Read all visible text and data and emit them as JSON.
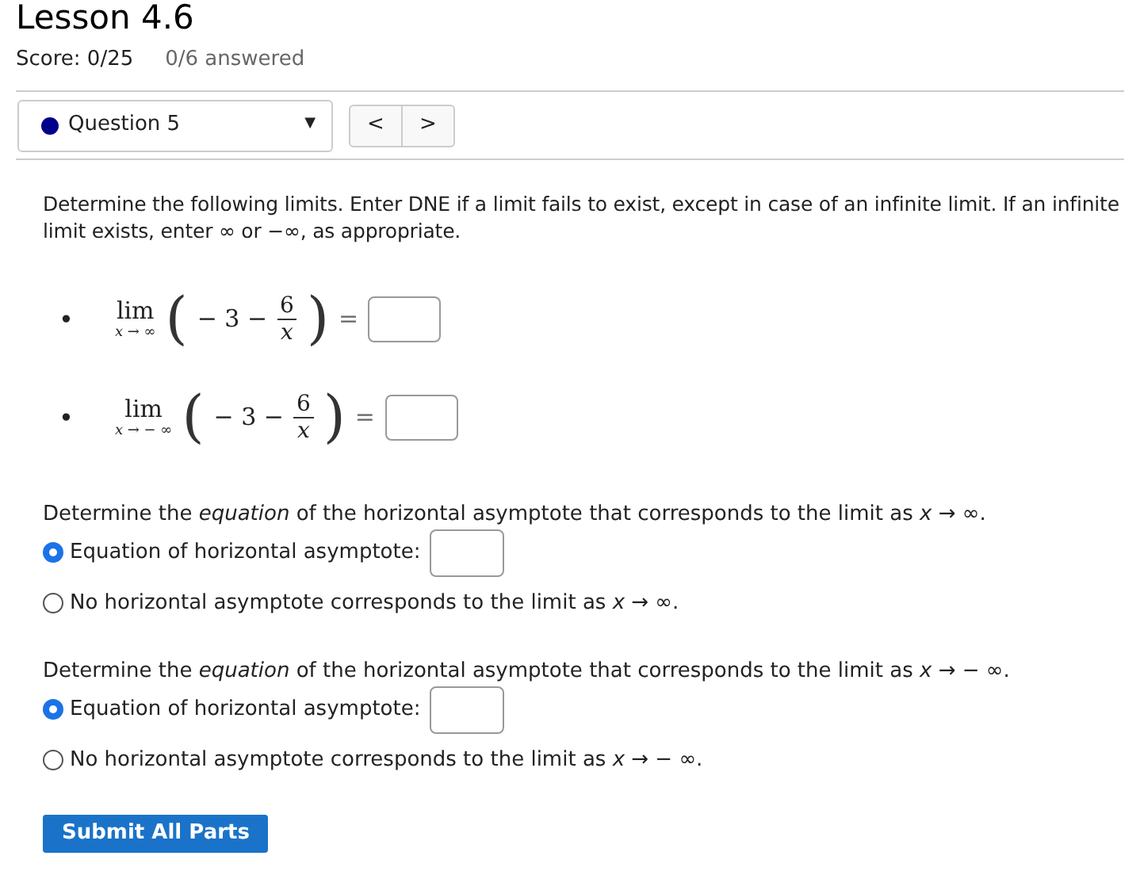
{
  "title": "Lesson 4.6",
  "score": "Score: 0/25",
  "answered": "0/6 answered",
  "question_select": {
    "label": "Question 5",
    "color": "#00008b",
    "caret": "▼"
  },
  "nav": {
    "prev": "<",
    "next": ">"
  },
  "instructions": "Determine the following limits. Enter DNE if a limit fails to exist, except in case of an infinite limit. If an infinite limit exists, enter ∞ or −∞, as appropriate.",
  "limits": [
    {
      "bullet": "•",
      "lim": "lim",
      "sub": "x → ∞",
      "open": "(",
      "expr": "− 3 −",
      "numerator": "6",
      "denominator": "x",
      "close": ")",
      "equals": "="
    },
    {
      "bullet": "•",
      "lim": "lim",
      "sub": "x → − ∞",
      "open": "(",
      "expr": "− 3 −",
      "numerator": "6",
      "denominator": "x",
      "close": ")",
      "equals": "="
    }
  ],
  "asymptote_parts": [
    {
      "prompt": "Determine the *equation* of the horizontal asymptote that corresponds to the limit as *x* → ∞.",
      "options": [
        {
          "kind": "input",
          "label": "Equation of horizontal asymptote:",
          "selected": true
        },
        {
          "kind": "plain",
          "label": "No horizontal asymptote corresponds to the limit as *x* → ∞.",
          "selected": false
        }
      ]
    },
    {
      "prompt": "Determine the *equation* of the horizontal asymptote that corresponds to the limit as *x* →  − ∞.",
      "options": [
        {
          "kind": "input",
          "label": "Equation of horizontal asymptote:",
          "selected": true
        },
        {
          "kind": "plain",
          "label": "No horizontal asymptote corresponds to the limit as *x* →  − ∞.",
          "selected": false
        }
      ]
    }
  ],
  "submit": "Submit All Parts"
}
